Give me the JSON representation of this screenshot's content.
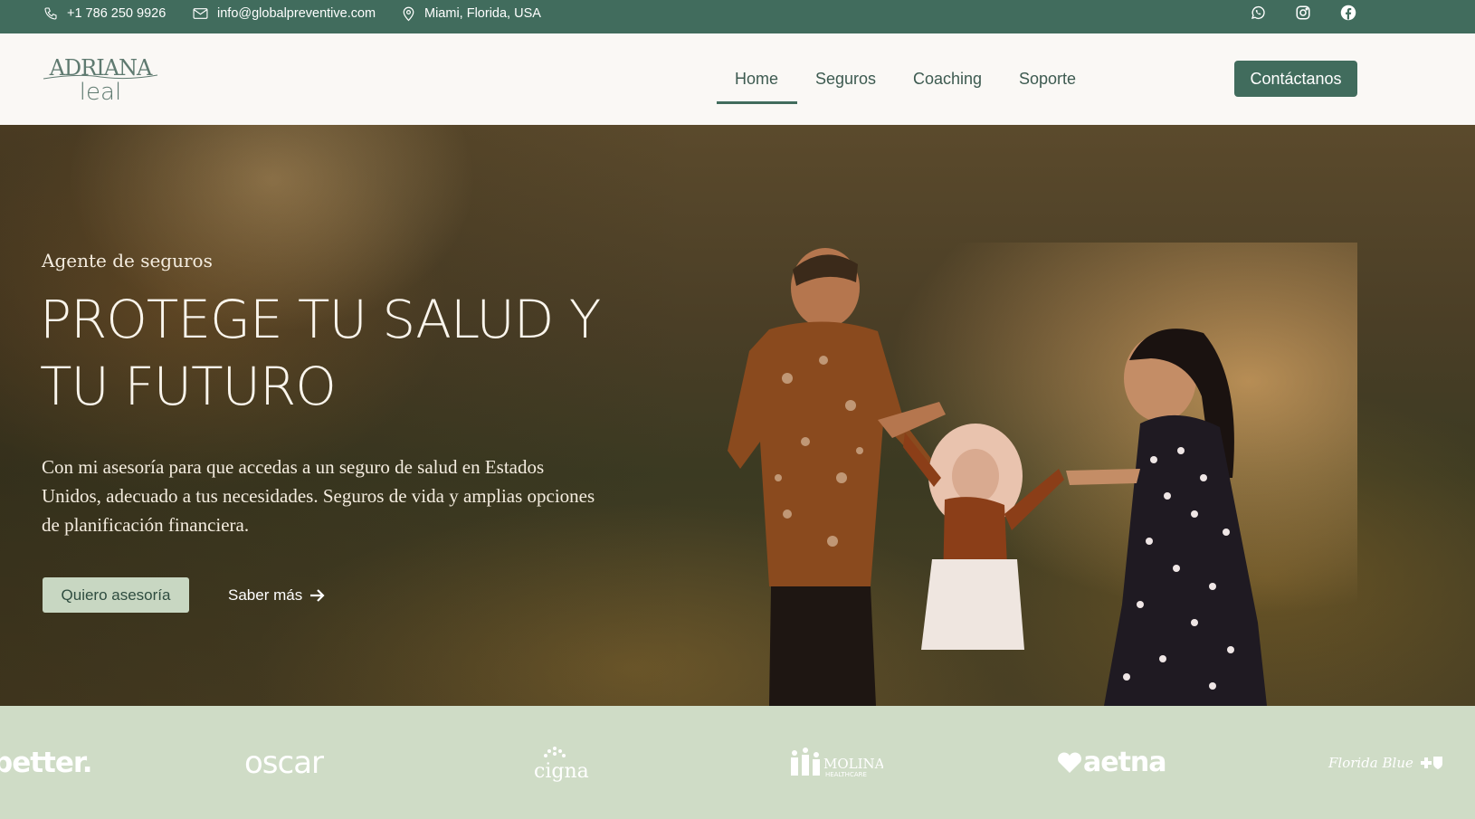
{
  "topbar": {
    "phone": "+1 786 250 9926",
    "email": "info@globalpreventive.com",
    "location": "Miami, Florida, USA",
    "social": [
      "whatsapp-icon",
      "instagram-icon",
      "facebook-icon"
    ]
  },
  "header": {
    "logo_line1": "ADRIANA",
    "logo_line2": "leal",
    "nav": [
      {
        "label": "Home",
        "active": true
      },
      {
        "label": "Seguros"
      },
      {
        "label": "Coaching"
      },
      {
        "label": "Soporte"
      }
    ],
    "cta_label": "Contáctanos"
  },
  "hero": {
    "eyebrow": "Agente de seguros",
    "headline_line1": "PROTEGE TU SALUD Y",
    "headline_line2": "TU FUTURO",
    "description": "Con mi asesoría para que accedas a un seguro de salud en Estados Unidos, adecuado a tus necesidades. Seguros de vida y amplias opciones de planificación financiera.",
    "primary_button": "Quiero asesoría",
    "secondary_button": "Saber más"
  },
  "partners": [
    "better.",
    "oscar",
    "cigna",
    "MOLINA",
    "HEALTHCARE",
    "aetna",
    "Florida Blue"
  ],
  "colors": {
    "brand_green": "#416c5d",
    "header_bg": "#faf8f5",
    "strip_bg": "#cfdcc6",
    "button_light": "#c8d7c2"
  }
}
